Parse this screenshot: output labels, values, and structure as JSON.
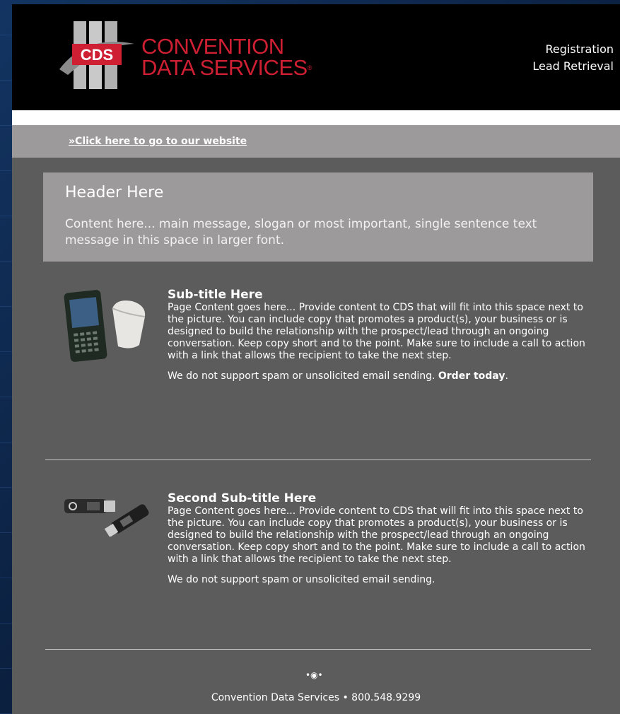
{
  "header": {
    "logo_text": "CDS",
    "brand_line1": "CONVENTION",
    "brand_line2": "DATA SERVICES",
    "link_registration": "Registration",
    "link_lead_retrieval": "Lead Retrieval"
  },
  "website_link": "»Click here to go to our website",
  "hero": {
    "title": "Header Here",
    "message": "Content here... main message, slogan or most important, single sentence text message in this space in larger font."
  },
  "section1": {
    "subtitle": "Sub-title Here",
    "body": "Page Content goes here... Provide content to CDS that will fit into this space next to the picture. You can include copy that promotes a product(s), your business or is designed to build the relationship with the prospect/lead through an ongoing conversation. Keep copy short and to the point. Make sure to include a call to action with a link that allows the recipient to take the next step.",
    "note": "We do not support spam or unsolicited email sending. ",
    "cta": "Order today",
    "cta_suffix": "."
  },
  "section2": {
    "subtitle": "Second Sub-title Here",
    "body": "Page Content goes here... Provide content to CDS that will fit into this space next to the picture. You can include copy that promotes a product(s), your business or is designed to build the relationship with the prospect/lead through an ongoing conversation. Keep copy short and to the point. Make sure to include a call to action with a link that allows the recipient to take the next step.",
    "note": "We do not support spam or unsolicited email sending."
  },
  "footer": {
    "text": "Convention Data Services  •  800.548.9299"
  },
  "colors": {
    "brand_red": "#cf1f33",
    "body_bg": "#5d5c5c",
    "bar_bg": "#9c9a9a"
  },
  "icons": [
    "cds-logo-icon",
    "handheld-scanner-icon",
    "usb-drive-icon",
    "footer-ornament-icon"
  ]
}
